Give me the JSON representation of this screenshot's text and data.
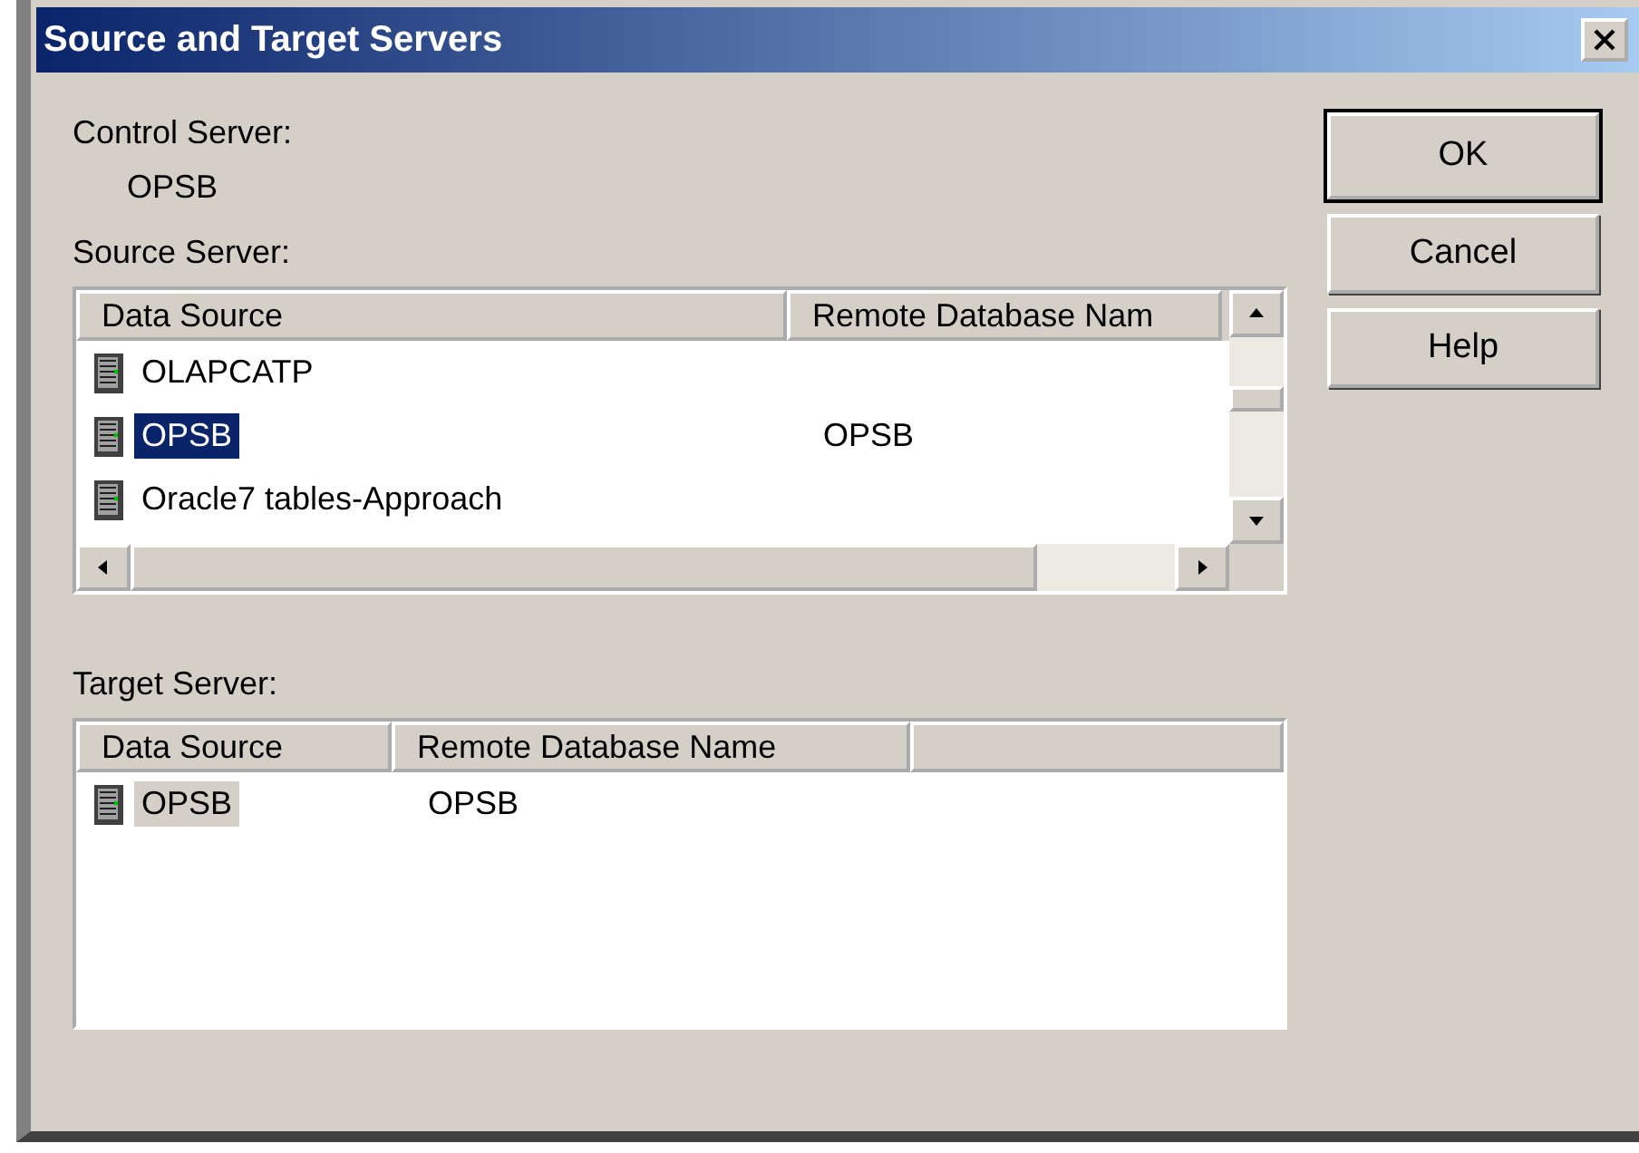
{
  "window": {
    "title": "Source and Target Servers"
  },
  "control_server": {
    "label": "Control Server:",
    "value": "OPSB"
  },
  "source_server": {
    "label": "Source Server:",
    "focused": true,
    "columns": [
      "Data Source",
      "Remote Database Nam"
    ],
    "rows": [
      {
        "data_source": "OLAPCATP",
        "remote_name": "",
        "selected": false
      },
      {
        "data_source": "OPSB",
        "remote_name": "OPSB",
        "selected": true
      },
      {
        "data_source": "Oracle7 tables-Approach",
        "remote_name": "",
        "selected": false
      }
    ]
  },
  "target_server": {
    "label": "Target Server:",
    "focused": false,
    "columns": [
      "Data Source",
      "Remote Database Name"
    ],
    "rows": [
      {
        "data_source": "OPSB",
        "remote_name": "OPSB",
        "selected": true
      }
    ]
  },
  "buttons": [
    {
      "label": "OK",
      "default": true
    },
    {
      "label": "Cancel",
      "default": false
    },
    {
      "label": "Help",
      "default": false
    }
  ]
}
